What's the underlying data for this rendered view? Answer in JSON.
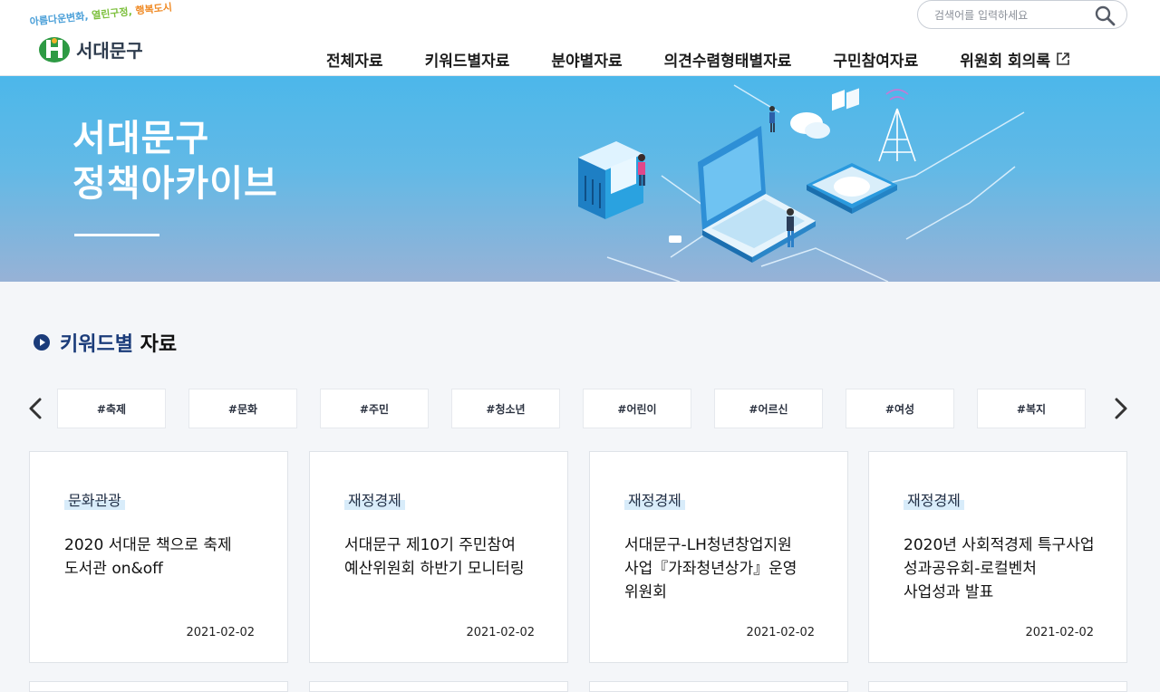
{
  "header": {
    "slogan": {
      "part1": "아름다운변화,",
      "part2": "열린구정,",
      "part3": "행복도시"
    },
    "logo_name": "서대문구",
    "search_placeholder": "검색어를 입력하세요"
  },
  "nav": {
    "items": [
      {
        "label": "전체자료"
      },
      {
        "label": "키워드별자료"
      },
      {
        "label": "분야별자료"
      },
      {
        "label": "의견수렴형태별자료"
      },
      {
        "label": "구민참여자료"
      },
      {
        "label": "위원회 회의록"
      }
    ]
  },
  "banner": {
    "line1": "서대문구",
    "line2": "정책아카이브"
  },
  "section": {
    "title_keyword": "키워드별",
    "title_rest": "자료"
  },
  "keywords": [
    "#축제",
    "#문화",
    "#주민",
    "#청소년",
    "#어린이",
    "#어르신",
    "#여성",
    "#복지"
  ],
  "cards": [
    {
      "category": "문화관광",
      "title": "2020 서대문 책으로 축제 도서관 on&off",
      "date": "2021-02-02"
    },
    {
      "category": "재정경제",
      "title": "서대문구 제10기 주민참여 예산위원회 하반기 모니터링",
      "date": "2021-02-02"
    },
    {
      "category": "재정경제",
      "title": "서대문구-LH청년창업지원 사업『가좌청년상가』운영 위원회",
      "date": "2021-02-02"
    },
    {
      "category": "재정경제",
      "title": "2020년 사회적경제 특구사업 성과공유회-로컬벤처 사업성과 발표",
      "date": "2021-02-02"
    }
  ],
  "colors": {
    "brand_navy": "#1b3c7a",
    "banner_top": "#4cb7ea",
    "banner_bottom": "#97b2d6",
    "category_highlight": "#d8ecfa"
  }
}
